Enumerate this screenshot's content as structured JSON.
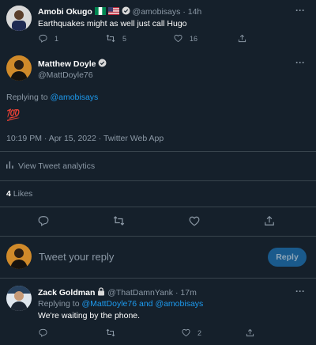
{
  "top_tweet": {
    "name": "Amobi Okugo",
    "handle": "@amobisays",
    "separator": "·",
    "time": "14h",
    "text": "Earthquakes might as well just call Hugo",
    "reply_count": "1",
    "retweet_count": "5",
    "like_count": "16",
    "more": "···"
  },
  "main_tweet": {
    "name": "Matthew Doyle",
    "handle": "@MattDoyle76",
    "replying_prefix": "Replying to",
    "replying_to": "@amobisays",
    "emoji": "💯",
    "timestamp": "10:19 PM · Apr 15, 2022 · Twitter Web App",
    "analytics_label": "View Tweet analytics",
    "likes_count": "4",
    "likes_label": "Likes",
    "more": "···"
  },
  "reply_box": {
    "placeholder": "Tweet your reply",
    "button_label": "Reply"
  },
  "reply_tweet": {
    "name": "Zack Goldman",
    "handle": "@ThatDamnYank",
    "separator": "·",
    "time": "17m",
    "replying_prefix": "Replying to",
    "replying_to_1": "@MattDoyle76",
    "replying_and": "and",
    "replying_to_2": "@amobisays",
    "text": "We're waiting by the phone.",
    "like_count": "2",
    "more": "···"
  },
  "colors": {
    "background": "#15202b",
    "accent": "#1d9bf0",
    "muted": "#8b98a5",
    "divider": "#38444d"
  }
}
